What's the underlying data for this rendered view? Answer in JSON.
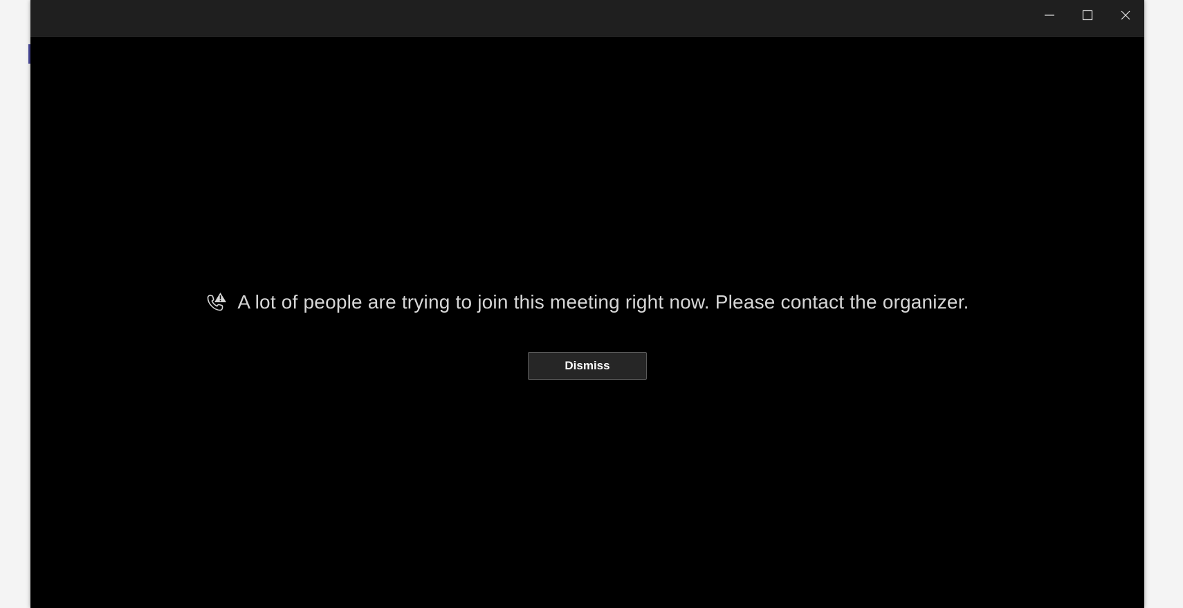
{
  "window": {
    "controls": {
      "minimize_icon": "minimize-icon",
      "maximize_icon": "maximize-icon",
      "close_icon": "close-icon"
    }
  },
  "notice": {
    "icon": "call-warning-icon",
    "message": "A lot of people are trying to join this meeting right now. Please contact the organizer.",
    "dismiss_label": "Dismiss"
  },
  "colors": {
    "background": "#000000",
    "titlebar": "#1f1f1f",
    "text": "#d6d6d6",
    "button_bg": "#262626",
    "button_border": "#5a5a5a"
  }
}
